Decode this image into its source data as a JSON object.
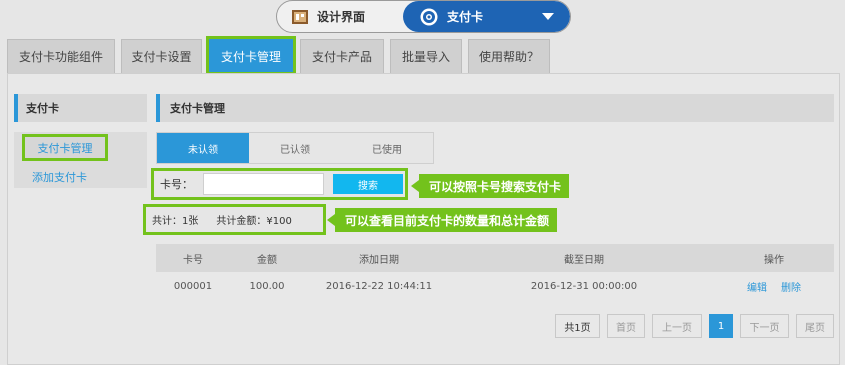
{
  "switcher": {
    "left_label": "设计界面",
    "right_label": "支付卡"
  },
  "tabs": [
    {
      "label": "支付卡功能组件"
    },
    {
      "label": "支付卡设置"
    },
    {
      "label": "支付卡管理"
    },
    {
      "label": "支付卡产品"
    },
    {
      "label": "批量导入"
    },
    {
      "label": "使用帮助？"
    }
  ],
  "sidebar": {
    "title": "支付卡",
    "items": [
      {
        "label": "支付卡管理"
      },
      {
        "label": "添加支付卡"
      }
    ]
  },
  "main": {
    "title": "支付卡管理",
    "subtabs": [
      {
        "label": "未认领"
      },
      {
        "label": "已认领"
      },
      {
        "label": "已使用"
      }
    ],
    "search": {
      "label": "卡号：",
      "value": "",
      "button": "搜索"
    },
    "summary": {
      "count": "共计：1张",
      "total": "共计金额：¥100"
    },
    "callouts": {
      "search": "可以按照卡号搜索支付卡",
      "summary": "可以查看目前支付卡的数量和总计金额"
    },
    "table": {
      "headers": [
        "卡号",
        "金额",
        "添加日期",
        "截至日期",
        "操作"
      ],
      "rows": [
        {
          "card": "000001",
          "amount": "100.00",
          "added": "2016-12-22 10:44:11",
          "expires": "2016-12-31 00:00:00",
          "edit": "编辑",
          "delete": "删除"
        }
      ]
    },
    "pager": {
      "total": "共1页",
      "first": "首页",
      "prev": "上一页",
      "current": "1",
      "next": "下一页",
      "last": "尾页"
    }
  },
  "colors": {
    "accent": "#2b97d8",
    "highlight": "#73c21c",
    "search_button": "#12b7ef",
    "switch_active": "#1e64b4"
  }
}
